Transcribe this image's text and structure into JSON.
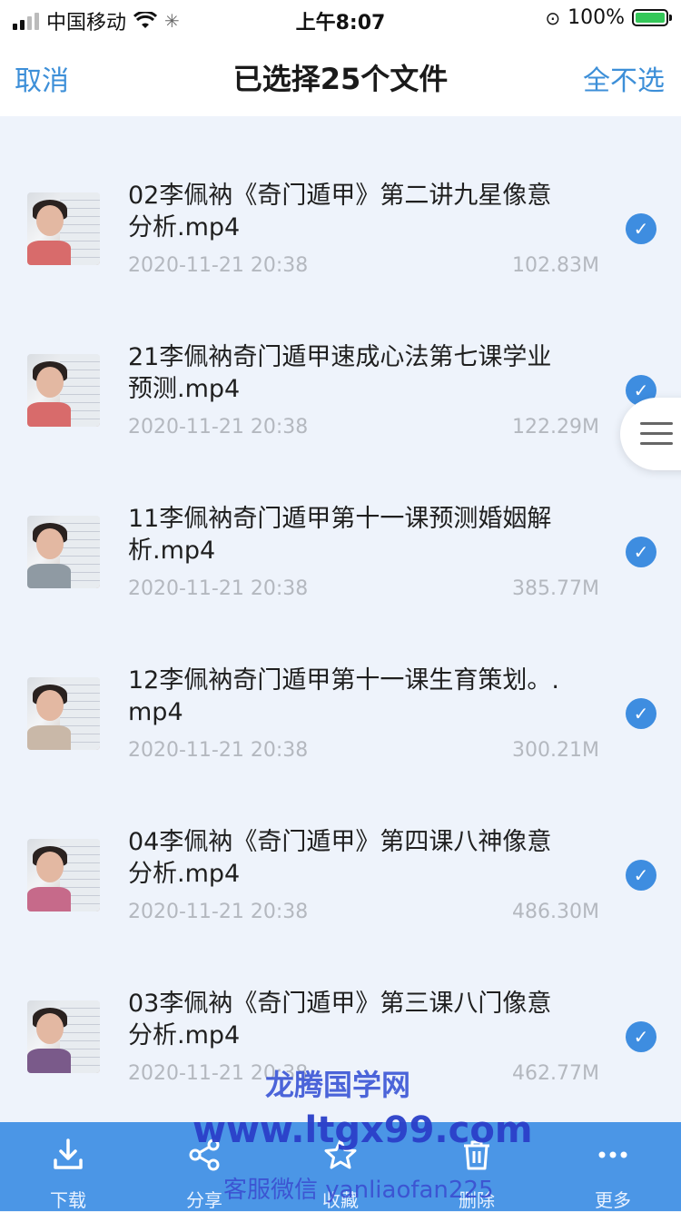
{
  "status_bar": {
    "carrier": "中国移动",
    "time": "上午8:07",
    "battery": "100%"
  },
  "nav": {
    "cancel": "取消",
    "title": "已选择25个文件",
    "deselect_all": "全不选"
  },
  "files": [
    {
      "name": "02李佩衲《奇门遁甲》第二讲九星像意分析.mp4",
      "date": "2020-11-21 20:38",
      "size": "102.83M",
      "selected": true
    },
    {
      "name": "21李佩衲奇门遁甲速成心法第七课学业预测.mp4",
      "date": "2020-11-21 20:38",
      "size": "122.29M",
      "selected": true
    },
    {
      "name": "11李佩衲奇门遁甲第十一课预测婚姻解析.mp4",
      "date": "2020-11-21 20:38",
      "size": "385.77M",
      "selected": true
    },
    {
      "name": "12李佩衲奇门遁甲第十一课生育策划。.mp4",
      "date": "2020-11-21 20:38",
      "size": "300.21M",
      "selected": true
    },
    {
      "name": "04李佩衲《奇门遁甲》第四课八神像意分析.mp4",
      "date": "2020-11-21 20:38",
      "size": "486.30M",
      "selected": true
    },
    {
      "name": "03李佩衲《奇门遁甲》第三课八门像意分析.mp4",
      "date": "2020-11-21 20:38",
      "size": "462.77M",
      "selected": true
    }
  ],
  "toolbar": {
    "download": "下载",
    "share": "分享",
    "favorite": "收藏",
    "delete": "删除",
    "more": "更多"
  },
  "watermark": {
    "site": "龙腾国学网",
    "url": "www.ltgx99.com",
    "contact": "客服微信 yanliaofan225"
  },
  "colors": {
    "accent": "#3d8fd8",
    "toolbar": "#4b96e6",
    "check": "#3e8de0",
    "background": "#eef3fb"
  },
  "icons": [
    "wifi-icon",
    "loading-icon",
    "rotation-lock-icon",
    "battery-icon",
    "check-icon",
    "menu-icon",
    "download-icon",
    "share-icon",
    "star-icon",
    "trash-icon",
    "more-icon"
  ]
}
